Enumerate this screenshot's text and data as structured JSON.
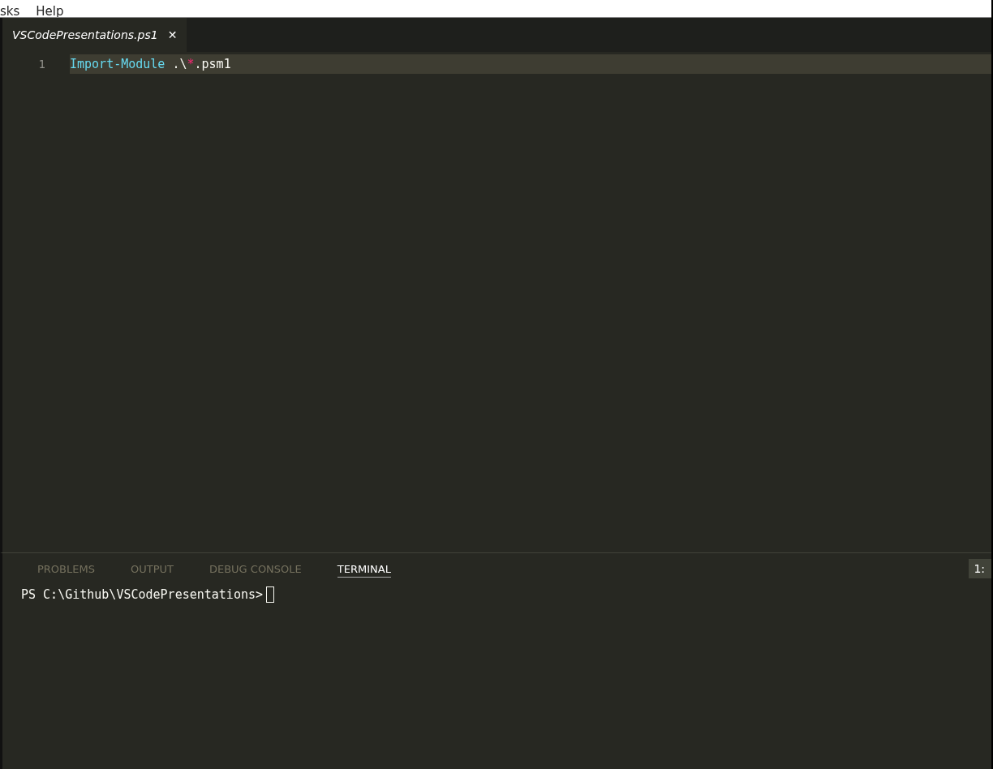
{
  "menu": [
    "sks",
    "Help"
  ],
  "tabs": [
    {
      "label": "VSCodePresentations.ps1",
      "selected": true,
      "close": "✕"
    }
  ],
  "editor": {
    "lines": [
      {
        "number": "1",
        "current": true,
        "tokens": [
          {
            "kind": "command",
            "text": "Import-Module"
          },
          {
            "kind": "plain",
            "text": " .\\"
          },
          {
            "kind": "operator",
            "text": "*"
          },
          {
            "kind": "plain",
            "text": ".psm1"
          }
        ]
      }
    ]
  },
  "panel": {
    "tabs": [
      {
        "label": "PROBLEMS",
        "selected": false
      },
      {
        "label": "OUTPUT",
        "selected": false
      },
      {
        "label": "DEBUG CONSOLE",
        "selected": false
      },
      {
        "label": "TERMINAL",
        "selected": true
      }
    ],
    "terminal_select": "1:",
    "terminal_lines": [
      "PS C:\\Github\\VSCodePresentations>"
    ]
  }
}
